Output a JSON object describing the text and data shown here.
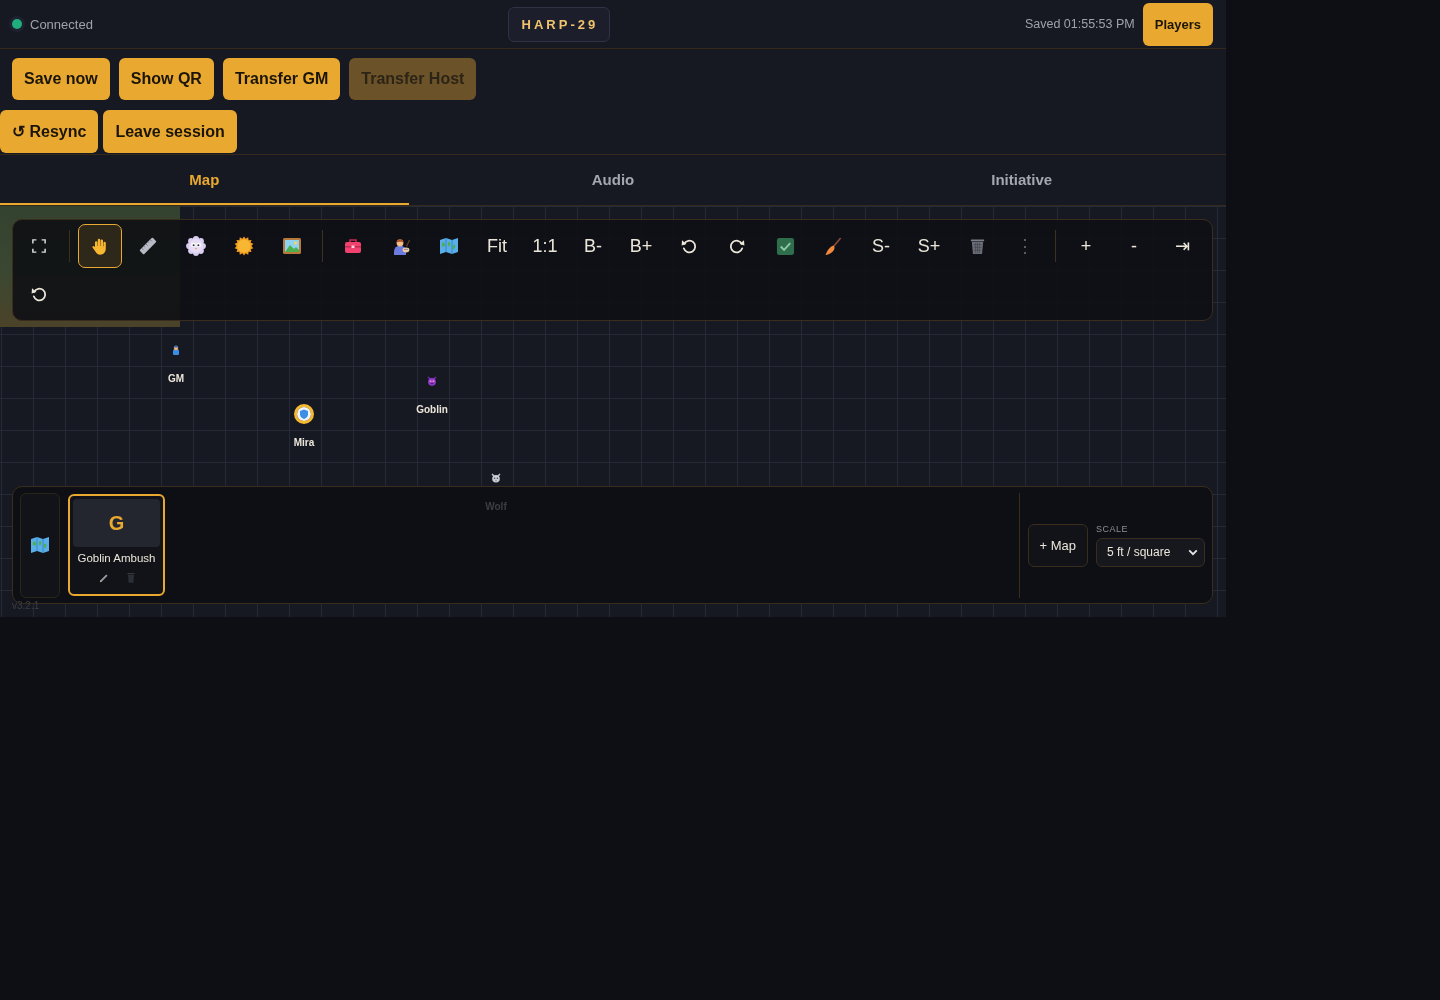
{
  "header": {
    "connection": {
      "label": "Connected",
      "online": true
    },
    "room_code": "HARP-29",
    "saved_status": "Saved 01:55:53 PM",
    "players_button": "Players"
  },
  "action_rows": [
    [
      {
        "label": "Save now",
        "disabled": false
      },
      {
        "label": "Show QR",
        "disabled": false
      },
      {
        "label": "Transfer GM",
        "disabled": false
      },
      {
        "label": "Transfer Host",
        "disabled": true
      }
    ],
    [
      {
        "label": "↺ Resync",
        "disabled": false
      },
      {
        "label": "Leave session",
        "disabled": false
      }
    ]
  ],
  "tabs": [
    {
      "label": "Map",
      "selected": true
    },
    {
      "label": "Audio",
      "selected": false
    },
    {
      "label": "Initiative",
      "selected": false
    }
  ],
  "map": {
    "toolbar": [
      {
        "kind": "icon",
        "selected": false
      },
      {
        "kind": "divider"
      },
      {
        "kind": "icon",
        "selected": true
      },
      {
        "kind": "icon",
        "selected": false
      },
      {
        "kind": "icon",
        "selected": false
      },
      {
        "kind": "icon",
        "selected": false
      },
      {
        "kind": "icon",
        "selected": false
      },
      {
        "kind": "divider"
      },
      {
        "kind": "icon",
        "selected": false
      },
      {
        "kind": "icon",
        "selected": false
      },
      {
        "kind": "icon",
        "selected": false
      },
      {
        "kind": "label",
        "label": "Fit",
        "selected": false
      },
      {
        "kind": "label",
        "label": "1:1",
        "selected": false
      },
      {
        "kind": "label",
        "label": "B-",
        "selected": false
      },
      {
        "kind": "label",
        "label": "B+",
        "selected": false
      },
      {
        "kind": "icon",
        "selected": false
      },
      {
        "kind": "icon",
        "selected": false
      },
      {
        "kind": "icon",
        "selected": false
      },
      {
        "kind": "icon",
        "selected": false
      },
      {
        "kind": "label",
        "label": "S-",
        "selected": false
      },
      {
        "kind": "label",
        "label": "S+",
        "selected": false
      },
      {
        "kind": "icon",
        "selected": false
      },
      {
        "kind": "more",
        "label": "⋮",
        "selected": false
      },
      {
        "kind": "divider"
      },
      {
        "kind": "label",
        "label": "+",
        "selected": false
      },
      {
        "kind": "label",
        "label": "-",
        "selected": false
      },
      {
        "kind": "label",
        "label": "⇥",
        "selected": false
      },
      {
        "kind": "icon",
        "selected": false
      }
    ],
    "tokens": [
      {
        "label": "GM",
        "selected": false
      },
      {
        "label": "Goblin",
        "selected": false
      },
      {
        "label": "Mira",
        "selected": true
      },
      {
        "label": "Wolf",
        "selected": false
      }
    ],
    "scene_panel": {
      "scenes": [
        {
          "initial": "G",
          "name": "Goblin Ambush",
          "selected": true
        }
      ],
      "add_map_button": "+ Map",
      "scale": {
        "label": "SCALE",
        "value": "5 ft / square"
      }
    },
    "version": "v3.2.1"
  }
}
